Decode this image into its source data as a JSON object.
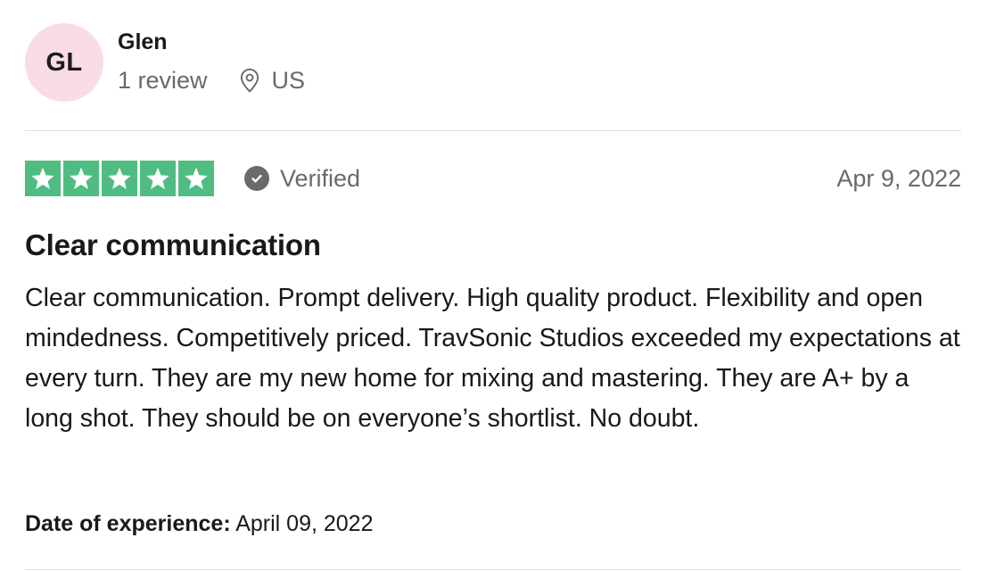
{
  "consumer": {
    "initials": "GL",
    "name": "Glen",
    "review_count": "1 review",
    "location": "US",
    "avatar_color": "#f9dce4"
  },
  "rating": {
    "stars": 5,
    "max_stars": 5,
    "star_color": "#4fbd82",
    "verified_label": "Verified",
    "date": "Apr 9, 2022"
  },
  "review": {
    "title": "Clear communication",
    "text": "Clear communication. Prompt delivery. High quality product. Flexibility and open mindedness. Competitively priced. TravSonic Studios exceeded my expectations at every turn. They are my new home for mixing and mastering. They are A+ by a long shot. They should be on everyone’s shortlist. No doubt."
  },
  "experience": {
    "label": "Date of experience:",
    "date": "April 09, 2022"
  }
}
